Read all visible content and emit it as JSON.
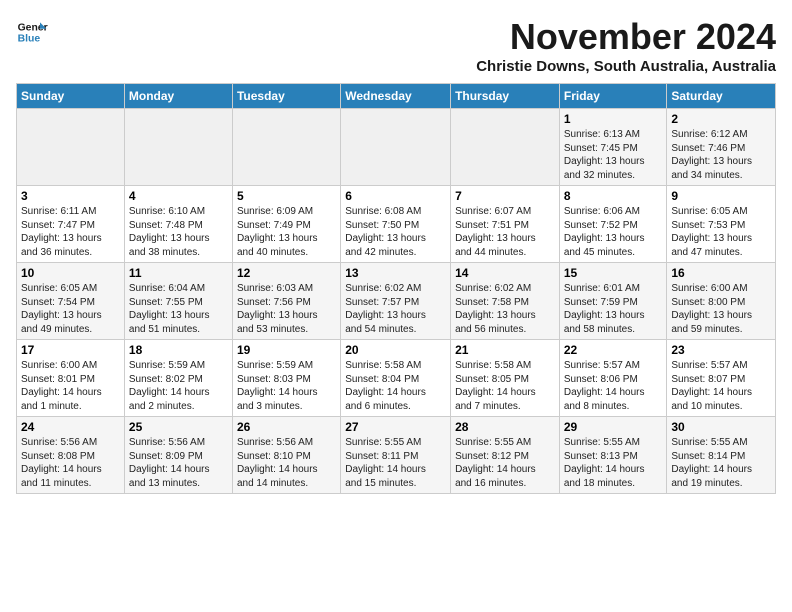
{
  "logo": {
    "line1": "General",
    "line2": "Blue"
  },
  "title": "November 2024",
  "subtitle": "Christie Downs, South Australia, Australia",
  "days_of_week": [
    "Sunday",
    "Monday",
    "Tuesday",
    "Wednesday",
    "Thursday",
    "Friday",
    "Saturday"
  ],
  "weeks": [
    [
      {
        "day": "",
        "info": ""
      },
      {
        "day": "",
        "info": ""
      },
      {
        "day": "",
        "info": ""
      },
      {
        "day": "",
        "info": ""
      },
      {
        "day": "",
        "info": ""
      },
      {
        "day": "1",
        "info": "Sunrise: 6:13 AM\nSunset: 7:45 PM\nDaylight: 13 hours\nand 32 minutes."
      },
      {
        "day": "2",
        "info": "Sunrise: 6:12 AM\nSunset: 7:46 PM\nDaylight: 13 hours\nand 34 minutes."
      }
    ],
    [
      {
        "day": "3",
        "info": "Sunrise: 6:11 AM\nSunset: 7:47 PM\nDaylight: 13 hours\nand 36 minutes."
      },
      {
        "day": "4",
        "info": "Sunrise: 6:10 AM\nSunset: 7:48 PM\nDaylight: 13 hours\nand 38 minutes."
      },
      {
        "day": "5",
        "info": "Sunrise: 6:09 AM\nSunset: 7:49 PM\nDaylight: 13 hours\nand 40 minutes."
      },
      {
        "day": "6",
        "info": "Sunrise: 6:08 AM\nSunset: 7:50 PM\nDaylight: 13 hours\nand 42 minutes."
      },
      {
        "day": "7",
        "info": "Sunrise: 6:07 AM\nSunset: 7:51 PM\nDaylight: 13 hours\nand 44 minutes."
      },
      {
        "day": "8",
        "info": "Sunrise: 6:06 AM\nSunset: 7:52 PM\nDaylight: 13 hours\nand 45 minutes."
      },
      {
        "day": "9",
        "info": "Sunrise: 6:05 AM\nSunset: 7:53 PM\nDaylight: 13 hours\nand 47 minutes."
      }
    ],
    [
      {
        "day": "10",
        "info": "Sunrise: 6:05 AM\nSunset: 7:54 PM\nDaylight: 13 hours\nand 49 minutes."
      },
      {
        "day": "11",
        "info": "Sunrise: 6:04 AM\nSunset: 7:55 PM\nDaylight: 13 hours\nand 51 minutes."
      },
      {
        "day": "12",
        "info": "Sunrise: 6:03 AM\nSunset: 7:56 PM\nDaylight: 13 hours\nand 53 minutes."
      },
      {
        "day": "13",
        "info": "Sunrise: 6:02 AM\nSunset: 7:57 PM\nDaylight: 13 hours\nand 54 minutes."
      },
      {
        "day": "14",
        "info": "Sunrise: 6:02 AM\nSunset: 7:58 PM\nDaylight: 13 hours\nand 56 minutes."
      },
      {
        "day": "15",
        "info": "Sunrise: 6:01 AM\nSunset: 7:59 PM\nDaylight: 13 hours\nand 58 minutes."
      },
      {
        "day": "16",
        "info": "Sunrise: 6:00 AM\nSunset: 8:00 PM\nDaylight: 13 hours\nand 59 minutes."
      }
    ],
    [
      {
        "day": "17",
        "info": "Sunrise: 6:00 AM\nSunset: 8:01 PM\nDaylight: 14 hours\nand 1 minute."
      },
      {
        "day": "18",
        "info": "Sunrise: 5:59 AM\nSunset: 8:02 PM\nDaylight: 14 hours\nand 2 minutes."
      },
      {
        "day": "19",
        "info": "Sunrise: 5:59 AM\nSunset: 8:03 PM\nDaylight: 14 hours\nand 3 minutes."
      },
      {
        "day": "20",
        "info": "Sunrise: 5:58 AM\nSunset: 8:04 PM\nDaylight: 14 hours\nand 6 minutes."
      },
      {
        "day": "21",
        "info": "Sunrise: 5:58 AM\nSunset: 8:05 PM\nDaylight: 14 hours\nand 7 minutes."
      },
      {
        "day": "22",
        "info": "Sunrise: 5:57 AM\nSunset: 8:06 PM\nDaylight: 14 hours\nand 8 minutes."
      },
      {
        "day": "23",
        "info": "Sunrise: 5:57 AM\nSunset: 8:07 PM\nDaylight: 14 hours\nand 10 minutes."
      }
    ],
    [
      {
        "day": "24",
        "info": "Sunrise: 5:56 AM\nSunset: 8:08 PM\nDaylight: 14 hours\nand 11 minutes."
      },
      {
        "day": "25",
        "info": "Sunrise: 5:56 AM\nSunset: 8:09 PM\nDaylight: 14 hours\nand 13 minutes."
      },
      {
        "day": "26",
        "info": "Sunrise: 5:56 AM\nSunset: 8:10 PM\nDaylight: 14 hours\nand 14 minutes."
      },
      {
        "day": "27",
        "info": "Sunrise: 5:55 AM\nSunset: 8:11 PM\nDaylight: 14 hours\nand 15 minutes."
      },
      {
        "day": "28",
        "info": "Sunrise: 5:55 AM\nSunset: 8:12 PM\nDaylight: 14 hours\nand 16 minutes."
      },
      {
        "day": "29",
        "info": "Sunrise: 5:55 AM\nSunset: 8:13 PM\nDaylight: 14 hours\nand 18 minutes."
      },
      {
        "day": "30",
        "info": "Sunrise: 5:55 AM\nSunset: 8:14 PM\nDaylight: 14 hours\nand 19 minutes."
      }
    ]
  ]
}
